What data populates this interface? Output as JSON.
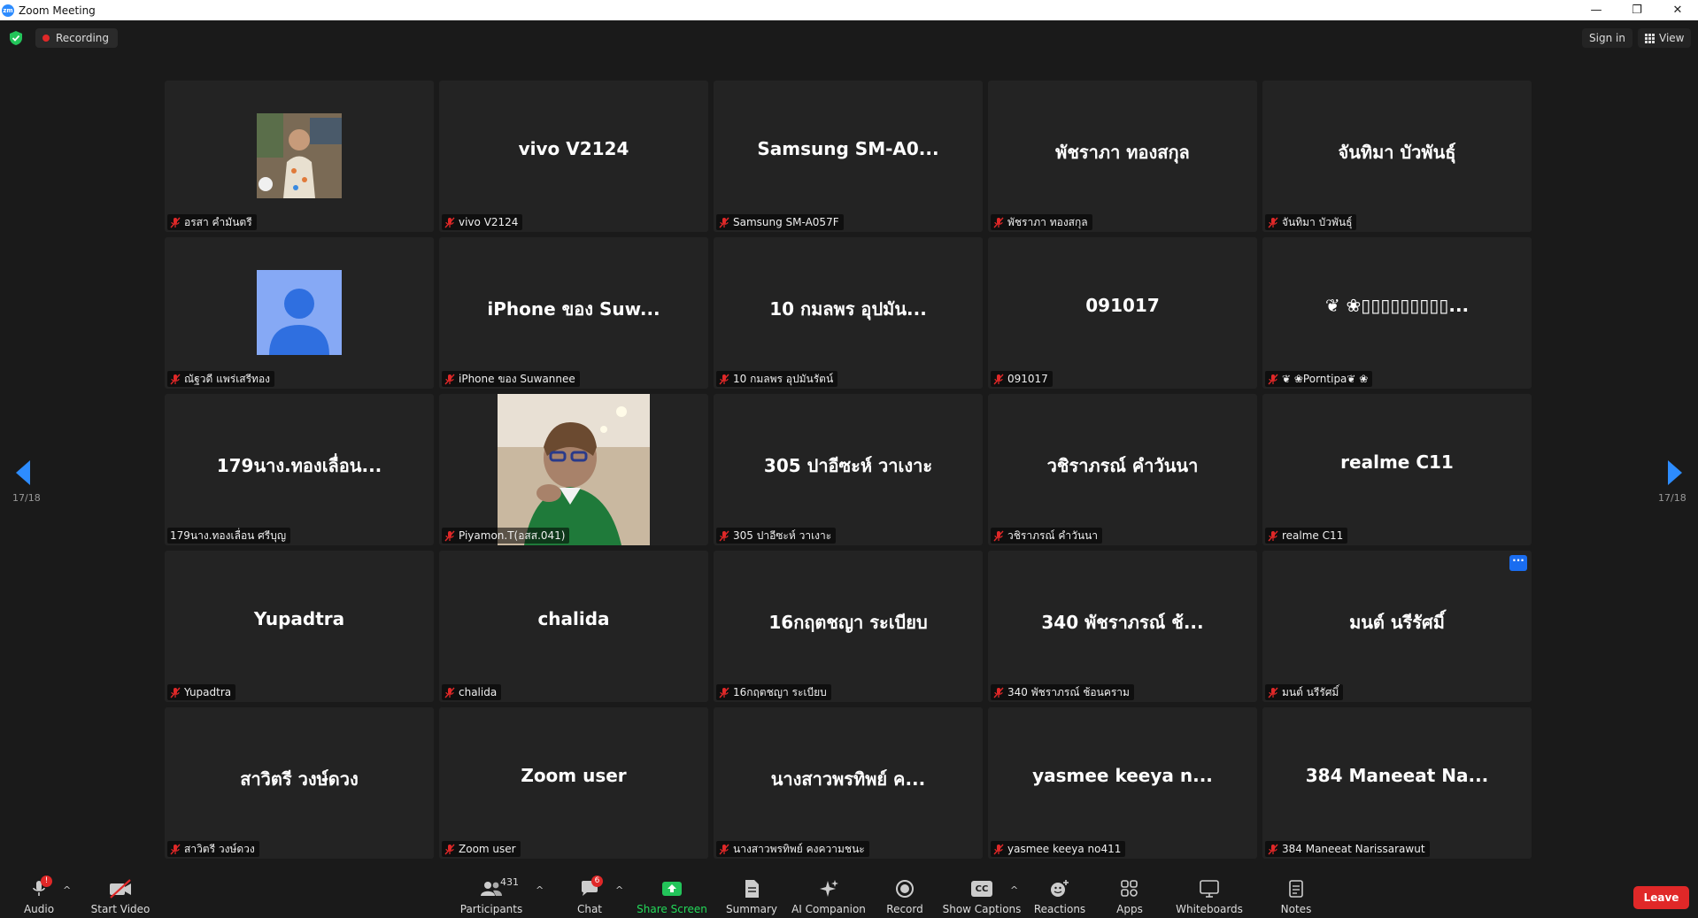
{
  "window": {
    "title": "Zoom Meeting",
    "logo_text": "zm",
    "controls": {
      "minimize": "—",
      "restore": "❐",
      "close": "✕"
    }
  },
  "topbar": {
    "recording_label": "Recording",
    "signin_label": "Sign in",
    "view_label": "View"
  },
  "gallery": {
    "page_indicator_left": "17/18",
    "page_indicator_right": "17/18",
    "tiles": [
      {
        "display": "",
        "label": "อรสา คำมันตรี",
        "kind": "photo",
        "muted": true
      },
      {
        "display": "vivo V2124",
        "label": "vivo V2124",
        "kind": "name",
        "muted": true
      },
      {
        "display": "Samsung  SM-A0...",
        "label": "Samsung SM-A057F",
        "kind": "name",
        "muted": true
      },
      {
        "display": "พัชราภา ทองสกุล",
        "label": "พัชราภา ทองสกุล",
        "kind": "name",
        "muted": true
      },
      {
        "display": "จันทิมา บัวพันธุ์",
        "label": "จันทิมา บัวพันธุ์",
        "kind": "name",
        "muted": true
      },
      {
        "display": "",
        "label": "ณัฐวดี แพร่เสรีทอง",
        "kind": "default-avatar",
        "muted": true
      },
      {
        "display": "iPhone ของ Suw...",
        "label": "iPhone ของ Suwannee",
        "kind": "name",
        "muted": true
      },
      {
        "display": "10 กมลพร อุปมัน...",
        "label": "10 กมลพร อุปมันรัตน์",
        "kind": "name",
        "muted": true
      },
      {
        "display": "091017",
        "label": "091017",
        "kind": "name",
        "muted": true
      },
      {
        "display": "❦ ❀▯▯▯▯▯▯▯▯▯...",
        "label": "❦ ❀Porntipa❦ ❀",
        "kind": "name",
        "muted": true
      },
      {
        "display": "179นาง.ทองเลื่อน...",
        "label": "179นาง.ทองเลื่อน ศรีบุญ",
        "kind": "name",
        "muted": false
      },
      {
        "display": "",
        "label": "Piyamon.T(อสส.041)",
        "kind": "video",
        "muted": true
      },
      {
        "display": "305 ปาอีซะห์ วาเงาะ",
        "label": "305 ปาอีซะห์ วาเงาะ",
        "kind": "name",
        "muted": true
      },
      {
        "display": "วชิราภรณ์  คำวันนา",
        "label": "วชิราภรณ์  คำวันนา",
        "kind": "name",
        "muted": true
      },
      {
        "display": "realme C11",
        "label": "realme C11",
        "kind": "name",
        "muted": true
      },
      {
        "display": "Yupadtra",
        "label": "Yupadtra",
        "kind": "name",
        "muted": true
      },
      {
        "display": "chalida",
        "label": "chalida",
        "kind": "name",
        "muted": true
      },
      {
        "display": "16กฤตชญา ระเบียบ",
        "label": "16กฤตชญา ระเบียบ",
        "kind": "name",
        "muted": true
      },
      {
        "display": "340 พัชราภรณ์ ช้...",
        "label": "340 พัชราภรณ์ ช้อนคราม",
        "kind": "name",
        "muted": true
      },
      {
        "display": "มนต์ นรีรัศมิ์",
        "label": "มนต์ นรีรัศมิ์",
        "kind": "name",
        "muted": true,
        "more": "···"
      },
      {
        "display": "สาวิตรี วงษ์ดวง",
        "label": "สาวิตรี วงษ์ดวง",
        "kind": "name",
        "muted": true
      },
      {
        "display": "Zoom user",
        "label": "Zoom user",
        "kind": "name",
        "muted": true
      },
      {
        "display": "นางสาวพรทิพย์ ค...",
        "label": "นางสาวพรทิพย์ คงความชนะ",
        "kind": "name",
        "muted": true
      },
      {
        "display": "yasmee keeya n...",
        "label": "yasmee keeya no411",
        "kind": "name",
        "muted": true
      },
      {
        "display": "384 Maneeat Na...",
        "label": "384 Maneeat Narissarawut",
        "kind": "name",
        "muted": true
      }
    ]
  },
  "toolbar": {
    "audio": {
      "label": "Audio",
      "badge": "!"
    },
    "start_video": {
      "label": "Start Video"
    },
    "participants": {
      "label": "Participants",
      "count": "431"
    },
    "chat": {
      "label": "Chat",
      "badge": "6"
    },
    "share_screen": {
      "label": "Share Screen"
    },
    "summary": {
      "label": "Summary"
    },
    "ai_companion": {
      "label": "AI Companion"
    },
    "record": {
      "label": "Record"
    },
    "show_captions": {
      "label": "Show Captions",
      "icon_text": "CC"
    },
    "reactions": {
      "label": "Reactions"
    },
    "apps": {
      "label": "Apps"
    },
    "whiteboards": {
      "label": "Whiteboards"
    },
    "notes": {
      "label": "Notes"
    },
    "caret": "^",
    "leave": {
      "label": "Leave"
    }
  },
  "colors": {
    "background": "#1a1a1a",
    "tile": "#232323",
    "accent_blue": "#2D8CFF",
    "leave_red": "#e02828",
    "share_green": "#23d959",
    "muted_red": "#e02828"
  }
}
